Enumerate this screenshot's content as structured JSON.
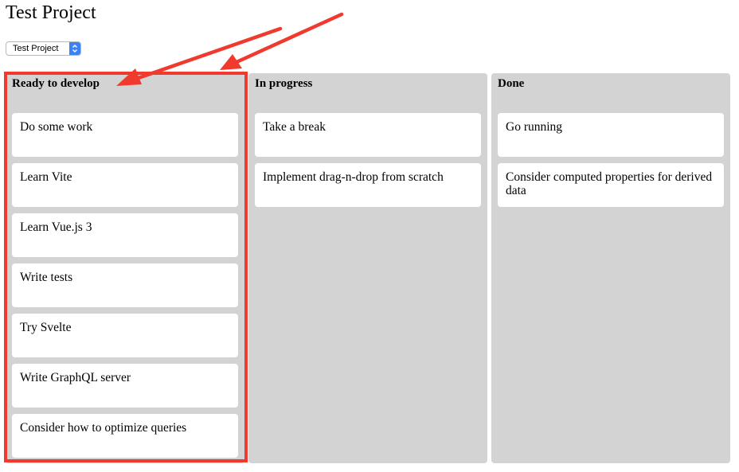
{
  "header": {
    "title": "Test Project"
  },
  "project_select": {
    "value": "Test Project"
  },
  "columns": [
    {
      "title": "Ready to develop",
      "cards": [
        "Do some work",
        "Learn Vite",
        "Learn Vue.js 3",
        "Write tests",
        "Try Svelte",
        "Write GraphQL server",
        "Consider how to optimize queries"
      ]
    },
    {
      "title": "In progress",
      "cards": [
        "Take a break",
        "Implement drag-n-drop from scratch"
      ]
    },
    {
      "title": "Done",
      "cards": [
        "Go running",
        "Consider computed properties for derived data"
      ]
    }
  ],
  "colors": {
    "column_background": "#d3d3d3",
    "card_background": "#ffffff",
    "annotation": "#f03a2e",
    "select_arrow": "#3b82f6"
  },
  "icons": {
    "select_arrow": "up-down-chevron-icon"
  }
}
